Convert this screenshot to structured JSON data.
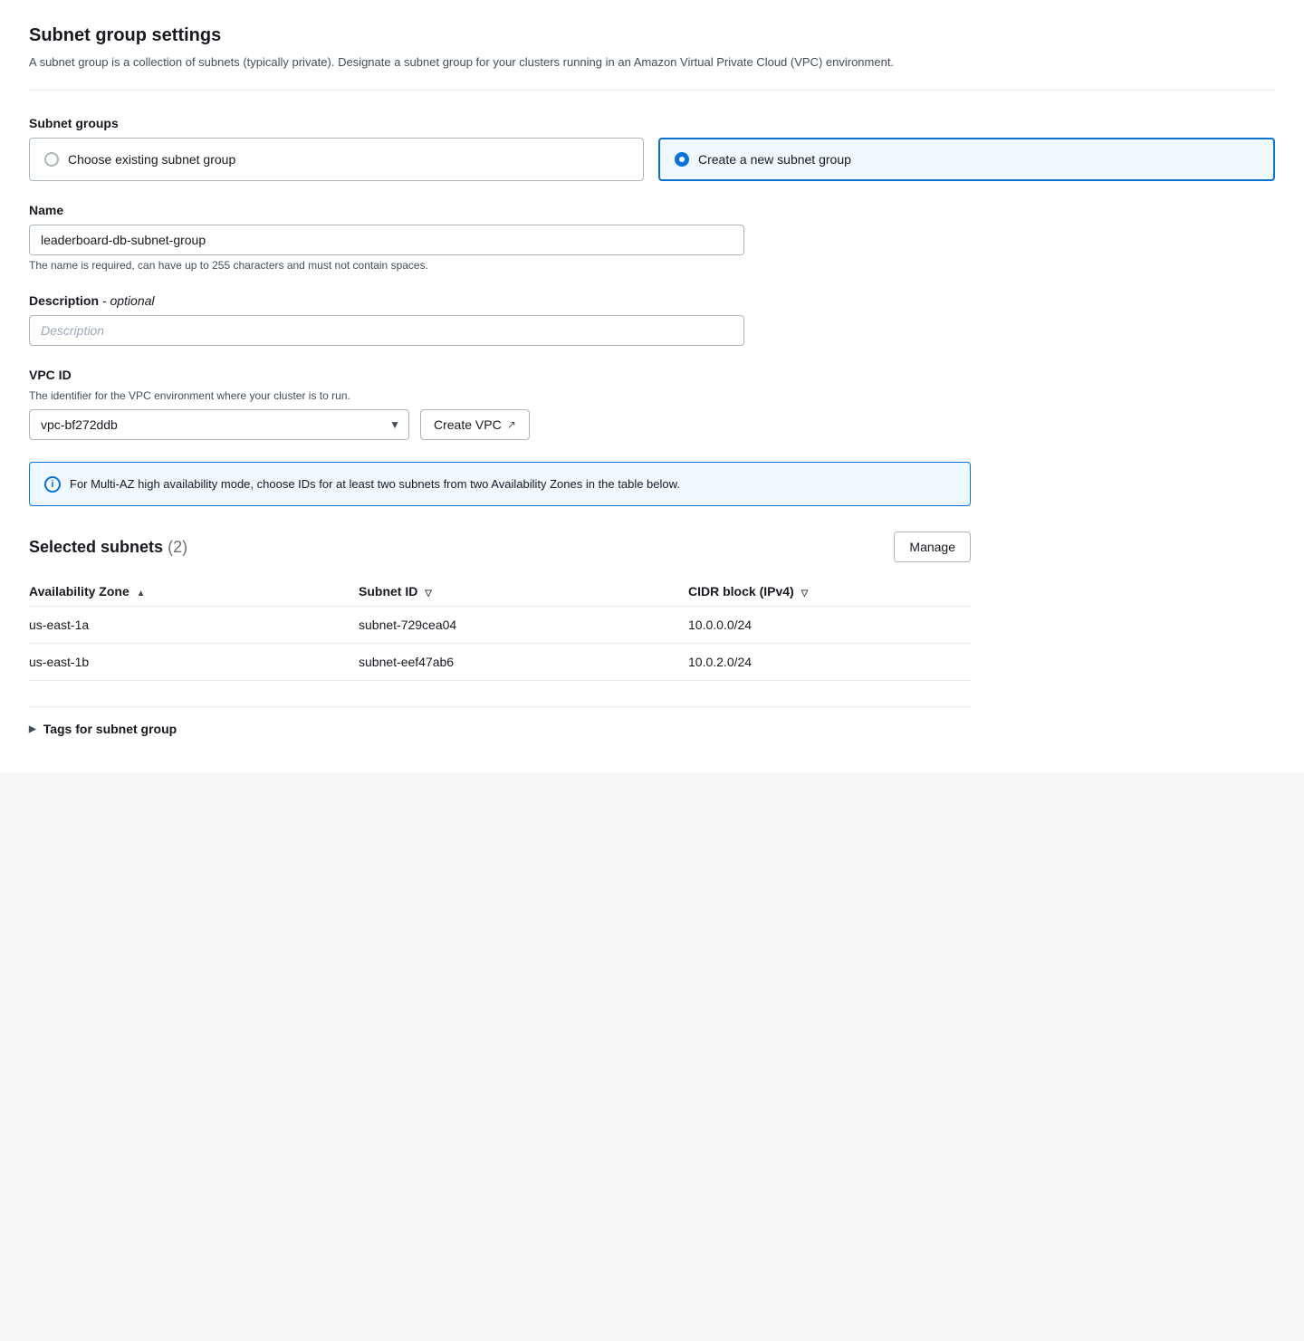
{
  "page": {
    "section_title": "Subnet group settings",
    "section_description": "A subnet group is a collection of subnets (typically private). Designate a subnet group for your clusters running in an Amazon Virtual Private Cloud (VPC) environment."
  },
  "subnet_groups": {
    "label": "Subnet groups",
    "option_existing": "Choose existing subnet group",
    "option_new": "Create a new subnet group",
    "selected": "new"
  },
  "name_field": {
    "label": "Name",
    "value": "leaderboard-db-subnet-group",
    "hint": "The name is required, can have up to 255 characters and must not contain spaces."
  },
  "description_field": {
    "label": "Description",
    "label_optional": "- optional",
    "placeholder": "Description"
  },
  "vpc_field": {
    "label": "VPC ID",
    "hint": "The identifier for the VPC environment where your cluster is to run.",
    "value": "vpc-bf272ddb",
    "create_vpc_label": "Create VPC",
    "external_icon": "↗"
  },
  "info_box": {
    "text": "For Multi-AZ high availability mode, choose IDs for at least two subnets from two Availability Zones in the table below."
  },
  "selected_subnets": {
    "title": "Selected subnets",
    "count": "2",
    "manage_label": "Manage",
    "columns": [
      {
        "label": "Availability Zone",
        "sort": "asc"
      },
      {
        "label": "Subnet ID",
        "sort": "desc"
      },
      {
        "label": "CIDR block (IPv4)",
        "sort": "desc"
      }
    ],
    "rows": [
      {
        "az": "us-east-1a",
        "subnet_id": "subnet-729cea04",
        "cidr": "10.0.0.0/24"
      },
      {
        "az": "us-east-1b",
        "subnet_id": "subnet-eef47ab6",
        "cidr": "10.0.2.0/24"
      }
    ]
  },
  "tags_section": {
    "label": "Tags for subnet group"
  }
}
